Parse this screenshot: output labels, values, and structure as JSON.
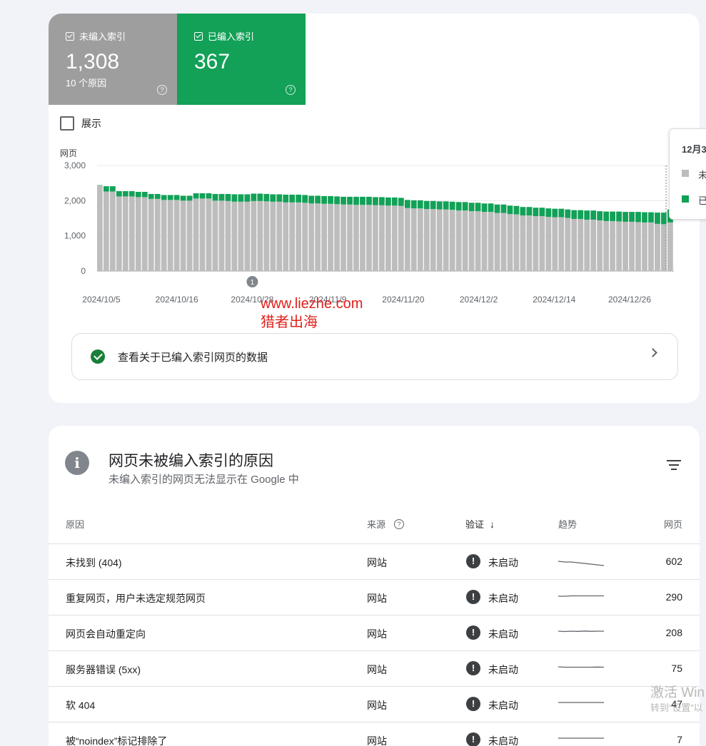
{
  "summary": {
    "not_indexed": {
      "label": "未编入索引",
      "count": "1,308",
      "reasons": "10 个原因"
    },
    "indexed": {
      "label": "已编入索引",
      "count": "367"
    },
    "show_label": "展示",
    "colors": {
      "not_indexed": "#9e9e9e",
      "indexed": "#12a157"
    }
  },
  "chart_data": {
    "type": "bar",
    "stacked": true,
    "ylabel": "网页",
    "ylim": [
      0,
      3000
    ],
    "y_ticks": [
      "3,000",
      "2,000",
      "1,000",
      "0"
    ],
    "x_tick_labels": [
      "2024/10/5",
      "2024/10/16",
      "2024/10/28",
      "2024/11/9",
      "2024/11/20",
      "2024/12/2",
      "2024/12/14",
      "2024/12/26"
    ],
    "annotation": "1",
    "grid": true,
    "series": [
      {
        "color": "#bdbdbd",
        "values": [
          2430,
          2260,
          2260,
          2120,
          2120,
          2120,
          2100,
          2100,
          2050,
          2050,
          2020,
          2020,
          2020,
          2000,
          2000,
          2060,
          2060,
          2060,
          2000,
          2000,
          1990,
          1970,
          1970,
          1970,
          1990,
          1990,
          1980,
          1970,
          1970,
          1950,
          1950,
          1950,
          1940,
          1920,
          1920,
          1910,
          1910,
          1900,
          1890,
          1890,
          1880,
          1880,
          1880,
          1870,
          1870,
          1860,
          1860,
          1850,
          1790,
          1780,
          1780,
          1760,
          1760,
          1750,
          1750,
          1740,
          1720,
          1720,
          1700,
          1700,
          1680,
          1680,
          1650,
          1650,
          1620,
          1610,
          1580,
          1580,
          1560,
          1560,
          1540,
          1530,
          1530,
          1510,
          1480,
          1480,
          1460,
          1460,
          1440,
          1420,
          1420,
          1410,
          1400,
          1400,
          1390,
          1380,
          1380,
          1340,
          1330,
          1380
        ]
      },
      {
        "color": "#12a157",
        "values": [
          10,
          150,
          150,
          150,
          150,
          150,
          150,
          150,
          140,
          140,
          140,
          140,
          140,
          140,
          140,
          150,
          150,
          150,
          190,
          190,
          200,
          210,
          210,
          210,
          210,
          210,
          210,
          210,
          210,
          220,
          220,
          220,
          220,
          220,
          220,
          220,
          220,
          220,
          220,
          220,
          230,
          230,
          230,
          230,
          230,
          230,
          230,
          230,
          230,
          230,
          230,
          230,
          230,
          230,
          230,
          230,
          240,
          240,
          240,
          240,
          240,
          240,
          240,
          240,
          240,
          240,
          240,
          240,
          240,
          240,
          240,
          240,
          240,
          240,
          250,
          250,
          260,
          260,
          260,
          270,
          270,
          280,
          280,
          280,
          290,
          290,
          290,
          320,
          330,
          367
        ]
      }
    ]
  },
  "tooltip": {
    "date": "12月3",
    "item1": "未",
    "item2": "已"
  },
  "watermark": {
    "line1": "www.liezhe.com",
    "line2": "猎者出海"
  },
  "link": {
    "label": "查看关于已编入索引网页的数据"
  },
  "reasons": {
    "title": "网页未被编入索引的原因",
    "subtitle": "未编入索引的网页无法显示在 Google 中",
    "headers": {
      "reason": "原因",
      "source": "来源",
      "validation": "验证",
      "trend": "趋势",
      "pages": "网页"
    },
    "rows": [
      {
        "reason": "未找到 (404)",
        "source": "网站",
        "status": "未启动",
        "pages": "602",
        "trend": [
          10,
          11,
          11,
          12,
          13,
          14,
          15,
          16
        ]
      },
      {
        "reason": "重复网页，用户未选定规范网页",
        "source": "网站",
        "status": "未启动",
        "pages": "290",
        "trend": [
          9,
          9,
          8.5,
          8.5,
          8.5,
          8.5,
          8.5,
          8.5
        ]
      },
      {
        "reason": "网页会自动重定向",
        "source": "网站",
        "status": "未启动",
        "pages": "208",
        "trend": [
          8,
          8.5,
          8,
          8.3,
          7.8,
          8.2,
          8,
          8
        ]
      },
      {
        "reason": "服务器错误 (5xx)",
        "source": "网站",
        "status": "未启动",
        "pages": "75",
        "trend": [
          8,
          8.5,
          8.5,
          8.5,
          8.5,
          8.5,
          8.3,
          8.5
        ]
      },
      {
        "reason": "软 404",
        "source": "网站",
        "status": "未启动",
        "pages": "47",
        "trend": [
          8,
          8,
          8,
          8,
          8,
          8,
          8,
          8
        ]
      },
      {
        "reason": "被“noindex”标记排除了",
        "source": "网站",
        "status": "未启动",
        "pages": "7",
        "trend": [
          8,
          8,
          8,
          8,
          8,
          8,
          8,
          8
        ]
      }
    ]
  },
  "os_watermark": {
    "line1": "激活 Win",
    "line2": "转到“设置”以"
  }
}
